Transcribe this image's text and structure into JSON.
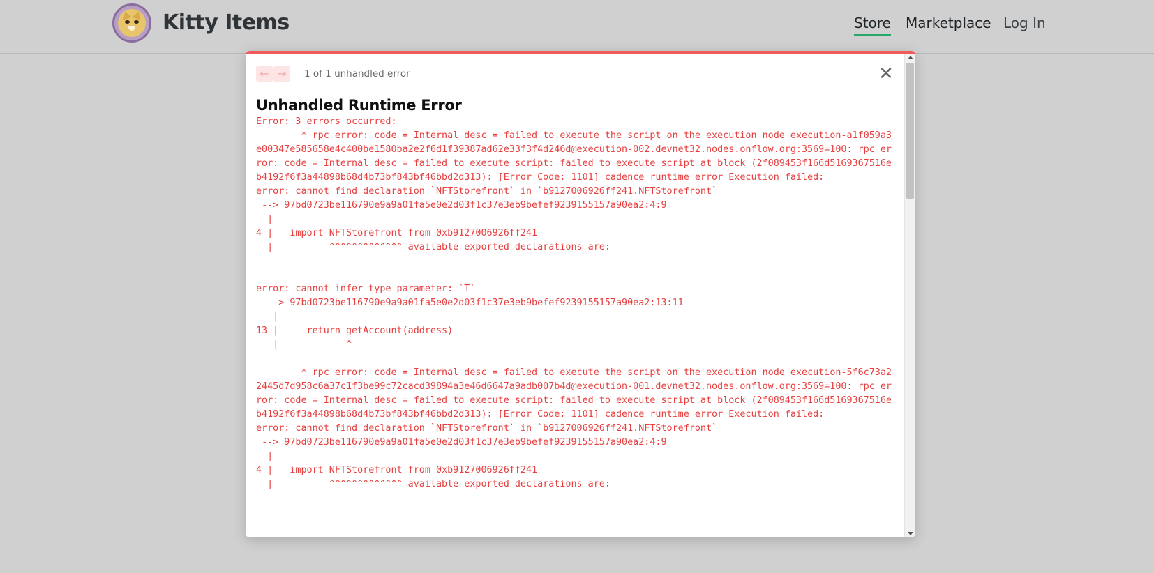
{
  "header": {
    "brand": "Kitty Items",
    "nav": {
      "store": "Store",
      "marketplace": "Marketplace",
      "login": "Log In"
    },
    "accent_color": "#2aa86c"
  },
  "dialog": {
    "pager": {
      "prev_icon": "arrow-left-icon",
      "next_icon": "arrow-right-icon",
      "prev_glyph": "←",
      "next_glyph": "→",
      "count_text": "1 of 1 unhandled error"
    },
    "close_glyph": "✕",
    "title": "Unhandled Runtime Error",
    "error_color": "#e74040",
    "error_text": "Error: 3 errors occurred:\n\t* rpc error: code = Internal desc = failed to execute the script on the execution node execution-a1f059a3e00347e585658e4c400be1580ba2e2f6d1f39387ad62e33f3f4d246d@execution-002.devnet32.nodes.onflow.org:3569=100: rpc error: code = Internal desc = failed to execute script: failed to execute script at block (2f089453f166d5169367516eb4192f6f3a44898b68d4b73bf843bf46bbd2d313): [Error Code: 1101] cadence runtime error Execution failed:\nerror: cannot find declaration `NFTStorefront` in `b9127006926ff241.NFTStorefront`\n --> 97bd0723be116790e9a9a01fa5e0e2d03f1c37e3eb9befef9239155157a90ea2:4:9\n  |\n4 |   import NFTStorefront from 0xb9127006926ff241\n  |          ^^^^^^^^^^^^^ available exported declarations are:\n\n\nerror: cannot infer type parameter: `T`\n  --> 97bd0723be116790e9a9a01fa5e0e2d03f1c37e3eb9befef9239155157a90ea2:13:11\n   |\n13 |     return getAccount(address)\n   |            ^\n\n\t* rpc error: code = Internal desc = failed to execute the script on the execution node execution-5f6c73a22445d7d958c6a37c1f3be99c72cacd39894a3e46d6647a9adb007b4d@execution-001.devnet32.nodes.onflow.org:3569=100: rpc error: code = Internal desc = failed to execute script: failed to execute script at block (2f089453f166d5169367516eb4192f6f3a44898b68d4b73bf843bf46bbd2d313): [Error Code: 1101] cadence runtime error Execution failed:\nerror: cannot find declaration `NFTStorefront` in `b9127006926ff241.NFTStorefront`\n --> 97bd0723be116790e9a9a01fa5e0e2d03f1c37e3eb9befef9239155157a90ea2:4:9\n  |\n4 |   import NFTStorefront from 0xb9127006926ff241\n  |          ^^^^^^^^^^^^^ available exported declarations are:"
  }
}
